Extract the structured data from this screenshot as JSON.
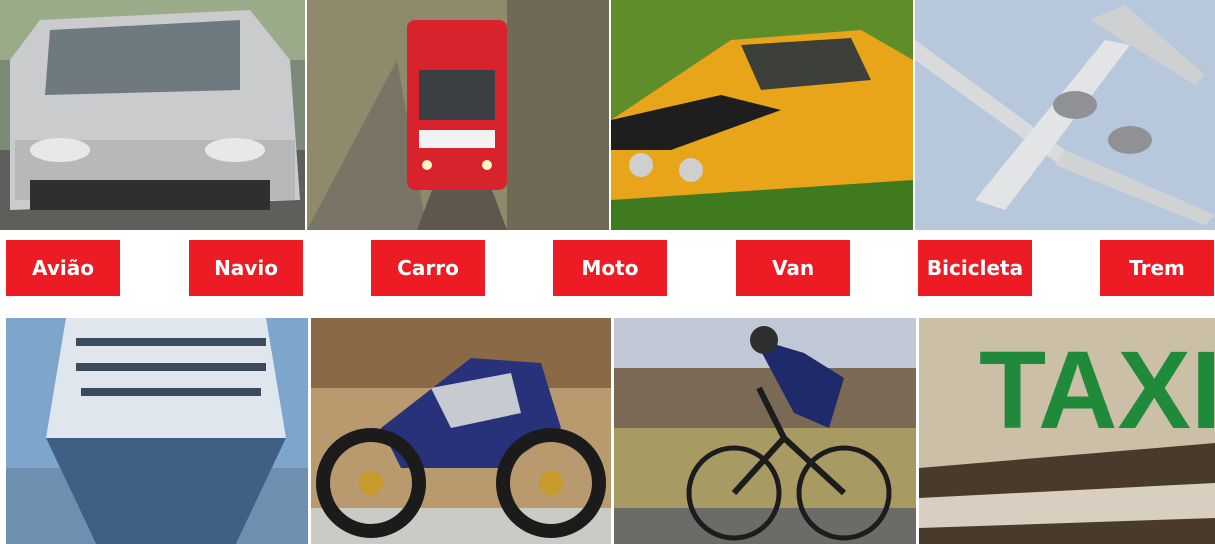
{
  "labels": [
    "Avião",
    "Navio",
    "Carro",
    "Moto",
    "Van",
    "Bicicleta",
    "Trem"
  ],
  "photos": {
    "top": [
      "van-photo",
      "train-photo",
      "car-photo",
      "airplane-photo"
    ],
    "bottom": [
      "ship-photo",
      "motorcycle-photo",
      "bicycle-photo",
      "taxi-photo"
    ]
  },
  "taxi_sign_text": "TAXI",
  "colors": {
    "label_background": "#ed1c24",
    "label_text": "#ffffff"
  }
}
